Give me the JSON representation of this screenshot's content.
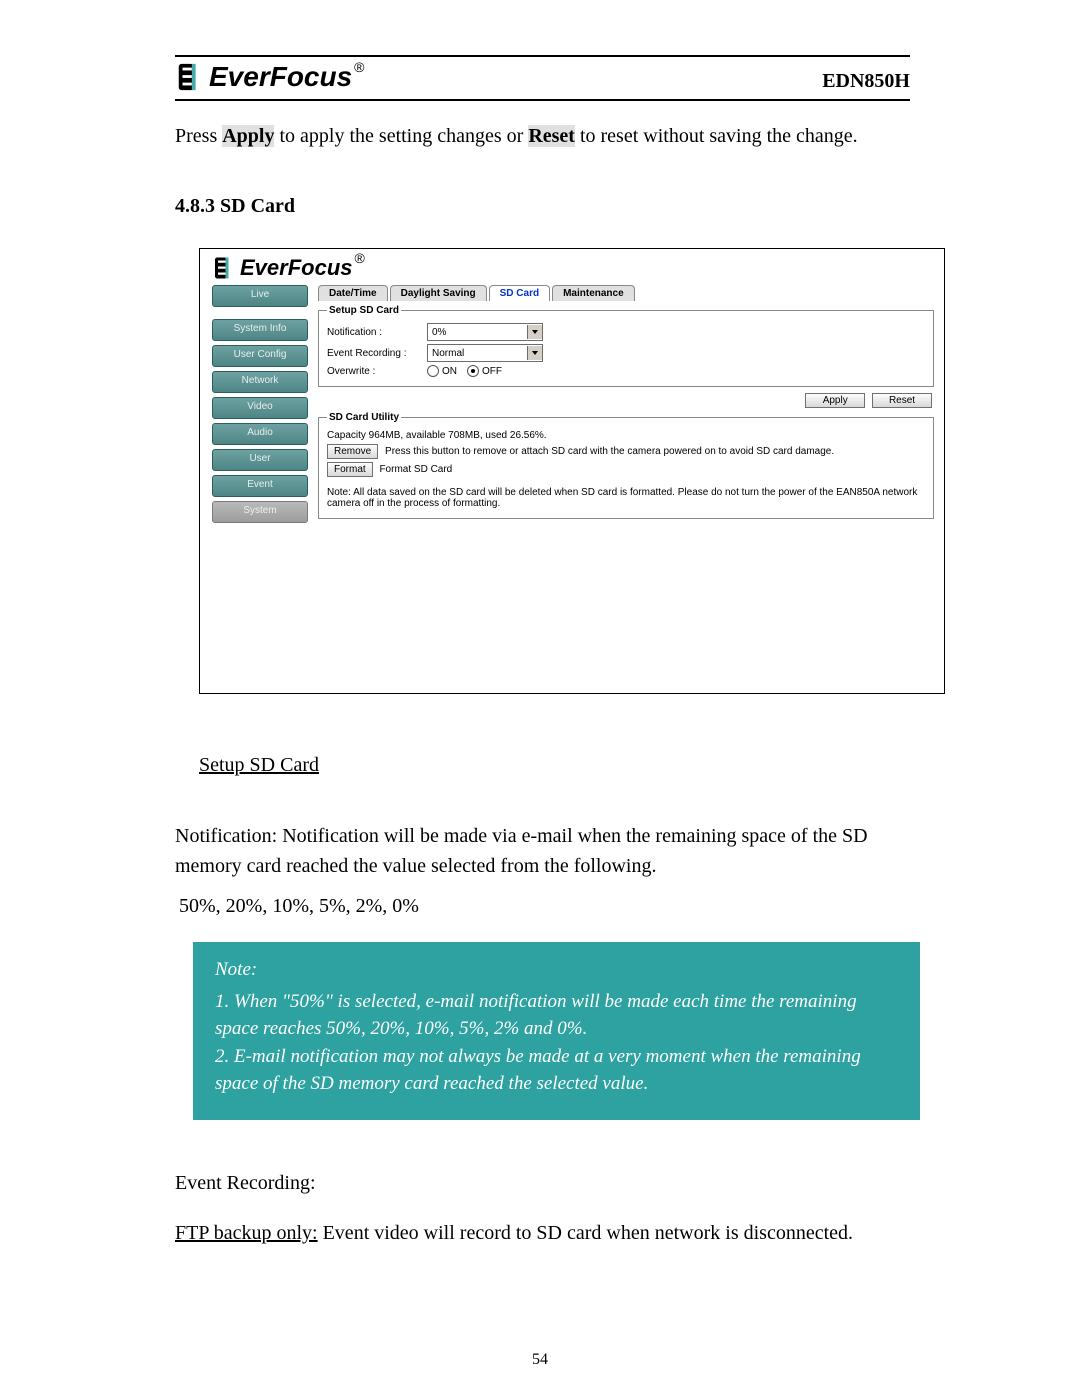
{
  "header": {
    "brand": "EverFocus",
    "reg": "®",
    "model": "EDN850H"
  },
  "intro": {
    "pre": "Press ",
    "apply": "Apply",
    "mid": " to apply the setting changes or ",
    "reset": "Reset",
    "post": " to reset without saving the change."
  },
  "section_heading": "4.8.3 SD Card",
  "app": {
    "brand": "EverFocus",
    "sidebar": [
      "Live",
      "System Info",
      "User Config",
      "Network",
      "Video",
      "Audio",
      "User",
      "Event",
      "System"
    ],
    "tabs": [
      "Date/Time",
      "Daylight Saving",
      "SD Card",
      "Maintenance"
    ],
    "setup": {
      "legend": "Setup SD Card",
      "notification_label": "Notification :",
      "notification_value": "0%",
      "event_label": "Event Recording :",
      "event_value": "Normal",
      "overwrite_label": "Overwrite :",
      "overwrite_on": "ON",
      "overwrite_off": "OFF",
      "apply": "Apply",
      "reset": "Reset"
    },
    "util": {
      "legend": "SD Card Utility",
      "capacity": "Capacity 964MB, available 708MB, used 26.56%.",
      "remove_btn": "Remove",
      "remove_text": "Press this button to remove or attach SD card with the camera powered on to avoid SD card damage.",
      "format_btn": "Format",
      "format_text": "Format SD Card",
      "note": "Note: All data saved on the SD card will be deleted when SD card is formatted. Please do not turn the power of the EAN850A network camera off in the process of formatting."
    }
  },
  "subheading": "Setup SD Card",
  "notif_paragraph": "Notification: Notification will be made via e-mail when the remaining space of the SD memory card reached the value selected from the following.",
  "percent_values": "50%, 20%, 10%, 5%, 2%, 0%",
  "notebox": {
    "title": "Note:",
    "line1": "1. When \"50%\" is selected, e-mail notification will be made each time the remaining space reaches 50%, 20%, 10%, 5%, 2% and 0%.",
    "line2": "2. E-mail notification may not always be made at a very moment when the remaining space of the SD memory card reached the selected value."
  },
  "event_heading": "Event Recording:",
  "ftp_label": "FTP backup only:",
  "ftp_text": " Event video will record to SD card when network is disconnected.",
  "page_number": "54"
}
